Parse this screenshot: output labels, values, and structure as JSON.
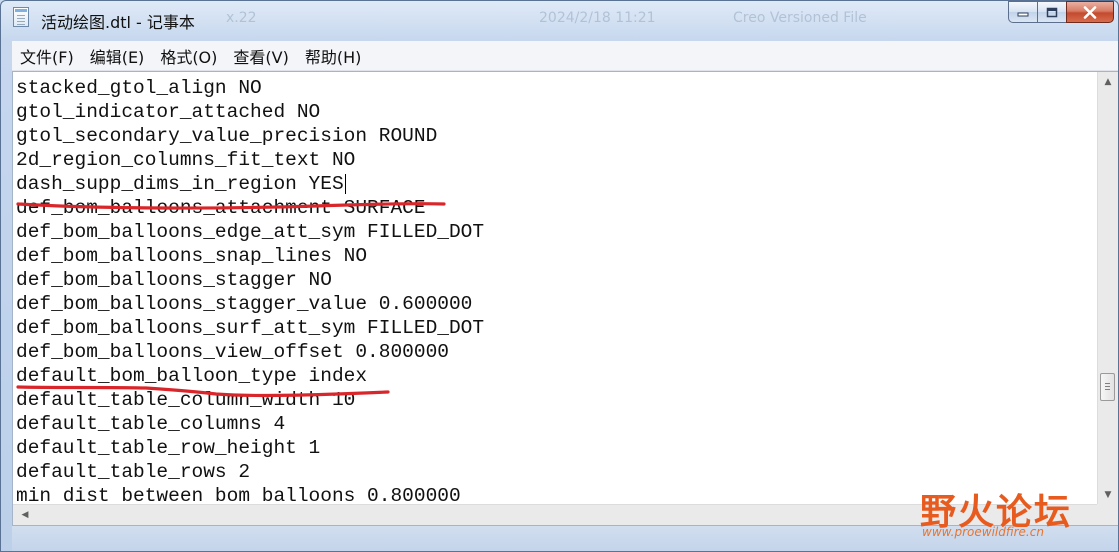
{
  "window": {
    "title": "活动绘图.dtl - 记事本",
    "background_ghost": {
      "version": "x.22",
      "date": "2024/2/18 11:21",
      "type": "Creo Versioned File"
    }
  },
  "menu": {
    "items": [
      {
        "label": "文件(F)"
      },
      {
        "label": "编辑(E)"
      },
      {
        "label": "格式(O)"
      },
      {
        "label": "查看(V)"
      },
      {
        "label": "帮助(H)"
      }
    ]
  },
  "editor": {
    "lines": [
      "stacked_gtol_align NO",
      "gtol_indicator_attached NO",
      "gtol_secondary_value_precision ROUND",
      "2d_region_columns_fit_text NO",
      "dash_supp_dims_in_region YES",
      "def_bom_balloons_attachment SURFACE",
      "def_bom_balloons_edge_att_sym FILLED_DOT",
      "def_bom_balloons_snap_lines NO",
      "def_bom_balloons_stagger NO",
      "def_bom_balloons_stagger_value 0.600000",
      "def_bom_balloons_surf_att_sym FILLED_DOT",
      "def_bom_balloons_view_offset 0.800000",
      "default_bom_balloon_type index",
      "default_table_column_width 10",
      "default_table_columns 4",
      "default_table_row_height 1",
      "default_table_rows 2",
      "min_dist_between_bom_balloons 0.800000"
    ],
    "highlighted_lines": [
      5,
      12
    ],
    "highlight_color": "#d9262a"
  },
  "watermark": {
    "main": "野火论坛",
    "url": "www.proewildfire.cn",
    "color": "#e85b1f"
  }
}
